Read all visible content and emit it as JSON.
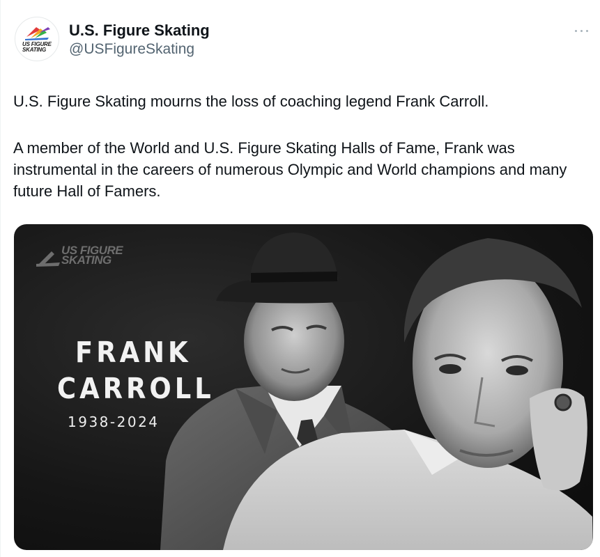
{
  "account": {
    "display_name": "U.S. Figure Skating",
    "handle": "@USFigureSkating",
    "avatar_logo_text": [
      "US FIGURE",
      "SKATING"
    ]
  },
  "tweet": {
    "paragraph_1": "U.S. Figure Skating mourns the loss of coaching legend Frank Carroll.",
    "paragraph_2": "A member of the World and U.S. Figure Skating Halls of Fame, Frank was instrumental in the careers of numerous Olympic and World champions and many future Hall of Famers."
  },
  "media": {
    "logo_text": [
      "US FIGURE",
      "SKATING"
    ],
    "name_line_1": "FRANK",
    "name_line_2": "CARROLL",
    "years": "1938-2024"
  },
  "colors": {
    "text_primary": "#0f1419",
    "text_secondary": "#536471",
    "media_background": "#111111"
  },
  "icons": {
    "more": "more-horizontal-icon",
    "avatar": "us-figure-skating-logo-icon"
  }
}
